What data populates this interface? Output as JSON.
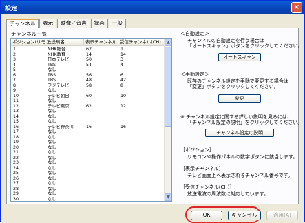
{
  "window": {
    "title": "設定",
    "close_glyph": "×"
  },
  "tabs": [
    {
      "label": "チャンネル",
      "active": true
    },
    {
      "label": "表示"
    },
    {
      "label": "映像／音声"
    },
    {
      "label": "録画"
    },
    {
      "label": "一般"
    }
  ],
  "channel_list": {
    "group_label": "チャンネル一覧",
    "columns": [
      "ポジション(リモコン)",
      "放送局名",
      "表示チャンネル",
      "受信チャンネル(CH)"
    ],
    "rows": [
      {
        "pos": "1",
        "name": "NHK総合",
        "disp": "62",
        "recv": "1"
      },
      {
        "pos": "2",
        "name": "NHK教育",
        "disp": "14",
        "recv": "14"
      },
      {
        "pos": "3",
        "name": "日本テレビ",
        "disp": "50",
        "recv": "3"
      },
      {
        "pos": "4",
        "name": "TBS",
        "disp": "54",
        "recv": "4"
      },
      {
        "pos": "5",
        "name": "なし",
        "disp": "",
        "recv": ""
      },
      {
        "pos": "6",
        "name": "TBS",
        "disp": "56",
        "recv": "6"
      },
      {
        "pos": "7",
        "name": "TBS",
        "disp": "48",
        "recv": "42"
      },
      {
        "pos": "8",
        "name": "フジテレビ",
        "disp": "58",
        "recv": "8"
      },
      {
        "pos": "9",
        "name": "なし",
        "disp": "",
        "recv": ""
      },
      {
        "pos": "10",
        "name": "テレビ朝日",
        "disp": "60",
        "recv": "10"
      },
      {
        "pos": "11",
        "name": "なし",
        "disp": "",
        "recv": ""
      },
      {
        "pos": "12",
        "name": "テレビ東京",
        "disp": "62",
        "recv": "12"
      },
      {
        "pos": "13",
        "name": "なし",
        "disp": "",
        "recv": ""
      },
      {
        "pos": "14",
        "name": "なし",
        "disp": "",
        "recv": ""
      },
      {
        "pos": "15",
        "name": "なし",
        "disp": "",
        "recv": ""
      },
      {
        "pos": "16",
        "name": "テレビ神奈川",
        "disp": "16",
        "recv": "16"
      },
      {
        "pos": "17",
        "name": "なし",
        "disp": "",
        "recv": ""
      },
      {
        "pos": "18",
        "name": "なし",
        "disp": "",
        "recv": ""
      },
      {
        "pos": "19",
        "name": "なし",
        "disp": "",
        "recv": ""
      },
      {
        "pos": "20",
        "name": "なし",
        "disp": "",
        "recv": ""
      },
      {
        "pos": "21",
        "name": "なし",
        "disp": "",
        "recv": ""
      },
      {
        "pos": "22",
        "name": "なし",
        "disp": "",
        "recv": ""
      },
      {
        "pos": "23",
        "name": "なし",
        "disp": "",
        "recv": ""
      },
      {
        "pos": "24",
        "name": "なし",
        "disp": "",
        "recv": ""
      },
      {
        "pos": "25",
        "name": "なし",
        "disp": "",
        "recv": ""
      },
      {
        "pos": "26",
        "name": "なし",
        "disp": "",
        "recv": ""
      },
      {
        "pos": "27",
        "name": "なし",
        "disp": "",
        "recv": ""
      },
      {
        "pos": "28",
        "name": "なし",
        "disp": "",
        "recv": ""
      },
      {
        "pos": "29",
        "name": "なし",
        "disp": "",
        "recv": ""
      },
      {
        "pos": "30",
        "name": "なし",
        "disp": "",
        "recv": ""
      }
    ],
    "scroll_up": "▲",
    "scroll_down": "▼"
  },
  "auto_setting": {
    "heading": "＜自動設定＞",
    "desc1": "チャンネルの自動設定を行う場合は",
    "desc2": "「オートスキャン」ボタンをクリックしてください。",
    "button": "オートスキャン"
  },
  "manual_setting": {
    "heading": "＜手動設定＞",
    "desc1": "既存のチャンネル設定を手動で変更する場合は",
    "desc2": "「変更」ボタンをクリックしてください。",
    "button": "変更"
  },
  "help": {
    "line1": "※ チャンネル設定に関する詳しい説明を見るには、",
    "line2": "「チャンネル設定の説明」をクリックしてください。",
    "button": "チャンネル設定の説明"
  },
  "legend": {
    "position_heading": "［ポジション］",
    "position_desc": "リモコンや操作パネルの数字ボタンに該当します。",
    "display_heading": "［表示チャンネル］",
    "display_desc": "テレビ画面上へ表示されるチャンネル番号です。",
    "receive_heading": "［受信チャンネル(CH)］",
    "receive_desc": "放送電波の周波数に対応しています。"
  },
  "footer": {
    "ok": "OK",
    "cancel": "キャンセル",
    "apply": "適用(A)"
  }
}
